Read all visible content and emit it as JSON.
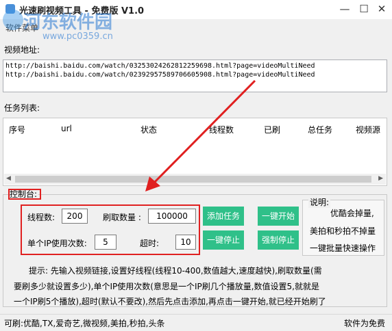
{
  "window": {
    "title": "光速刷视频工具 - 免费版 V1.0",
    "menu_label": "软件菜单"
  },
  "watermark": {
    "text": "河东软件园",
    "url": "www.pc0359.cn"
  },
  "video_address": {
    "label": "视频地址:",
    "urls": "http://baishi.baidu.com/watch/03253024262812259698.html?page=videoMultiNeed\nhttp://baishi.baidu.com/watch/02392957589706605908.html?page=videoMultiNeed"
  },
  "task_list": {
    "label": "任务列表:",
    "columns": [
      "序号",
      "url",
      "状态",
      "线程数",
      "已刷",
      "总任务",
      "视频源"
    ]
  },
  "control": {
    "group_label": "控制台:",
    "threads_label": "线程数:",
    "threads_value": "200",
    "count_label": "刷取数量 :",
    "count_value": "100000",
    "per_ip_label": "单个IP使用次数:",
    "per_ip_value": "5",
    "timeout_label": "超时:",
    "timeout_value": "10",
    "buttons": {
      "add": "添加任务",
      "start": "一键开始",
      "stop": "一键停止",
      "force_stop": "强制停止"
    }
  },
  "notes": {
    "title": "说明:",
    "lines": [
      "优酷会掉量,",
      "美拍和秒拍不掉量",
      "一键批量快速操作"
    ]
  },
  "hint": {
    "line1": "提示: 先输入视频链接,设置好线程(线程10-400,数值越大,速度越快),刷取数量(需",
    "line2": "要刷多少就设置多少),单个IP使用次数(意思是一个IP刷几个播放量,数值设置5,就就是",
    "line3": "一个IP刷5个播放),超时(默认不要改),然后先点击添加,再点击一键开始,就已经开始刷了"
  },
  "status": {
    "left": "可刷:优酷,TX,爱奇艺,微视频,美拍,秒拍,头条",
    "right": "软件为免费"
  },
  "colors": {
    "accent_button": "#2fc089",
    "highlight_red": "#e02020"
  }
}
